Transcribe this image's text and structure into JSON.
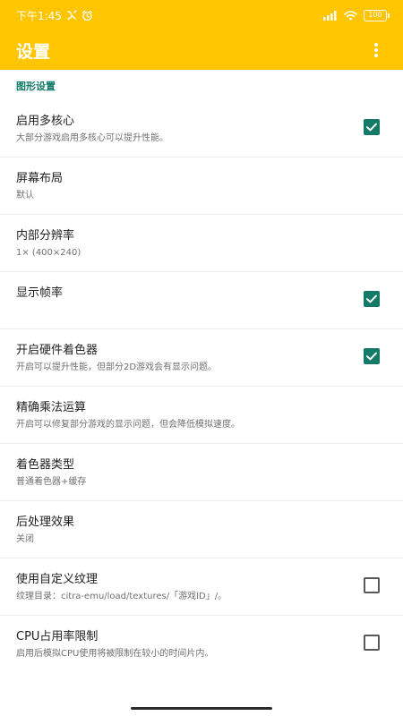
{
  "status_bar": {
    "time": "下午1:45",
    "battery_level": "100",
    "icons": [
      "notification-icon",
      "alarm-icon",
      "signal-icon",
      "wifi-icon",
      "battery-icon"
    ]
  },
  "app_bar": {
    "title": "设置",
    "overflow_icon": "more-vert-icon"
  },
  "section": {
    "title": "图形设置"
  },
  "settings": [
    {
      "title": "启用多核心",
      "summary": "大部分游戏启用多核心可以提升性能。",
      "checkbox": "checked"
    },
    {
      "title": "屏幕布局",
      "summary": "默认",
      "checkbox": "none"
    },
    {
      "title": "内部分辨率",
      "summary": "1× (400×240)",
      "checkbox": "none"
    },
    {
      "title": "显示帧率",
      "summary": "",
      "checkbox": "checked"
    },
    {
      "title": "开启硬件着色器",
      "summary": "开启可以提升性能，但部分2D游戏会有显示问题。",
      "checkbox": "checked"
    },
    {
      "title": "精确乘法运算",
      "summary": "开启可以修复部分游戏的显示问题，但会降低模拟速度。",
      "checkbox": "none"
    },
    {
      "title": "着色器类型",
      "summary": "普通着色器+缓存",
      "checkbox": "none"
    },
    {
      "title": "后处理效果",
      "summary": "关闭",
      "checkbox": "none"
    },
    {
      "title": "使用自定义纹理",
      "summary": "纹理目录：citra-emu/load/textures/「游戏ID」/。",
      "checkbox": "unchecked"
    },
    {
      "title": "CPU占用率限制",
      "summary": "启用后模拟CPU使用将被限制在较小的时间片内。",
      "checkbox": "unchecked"
    }
  ],
  "colors": {
    "accent": "#ffc500",
    "checkbox": "#127a67",
    "section_header": "#127a67"
  }
}
